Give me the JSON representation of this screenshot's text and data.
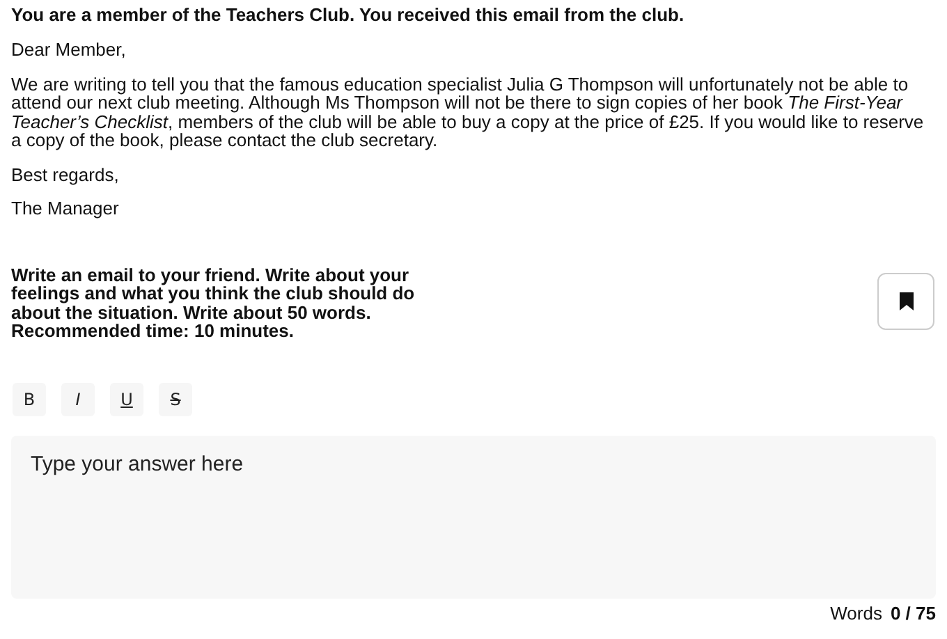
{
  "intro": "You are a member of the Teachers Club. You received this email from the club.",
  "email": [
    "Dear Member,",
    "We are writing to tell you that the famous education specialist Julia G Thompson will unfortunately not be able to attend our next club meeting. Although Ms Thompson will not be there to sign copies of her book *The First-Year Teacher’s Checklist*, members of the club will be able to buy a copy at the price of £25. If you would like to reserve a copy of the book, please contact the club secretary.",
    "Best regards,",
    "The Manager"
  ],
  "task": "Write an email to your friend. Write about your feelings and what you think the club should do about the situation. Write about 50 words. Recommended time: 10 minutes.",
  "bookmark": {
    "on": true
  },
  "toolbar": [
    {
      "label": "B",
      "kind": "bold"
    },
    {
      "label": "I",
      "kind": "italic"
    },
    {
      "label": "U",
      "kind": "underline"
    },
    {
      "label": "S",
      "kind": "strike"
    }
  ],
  "answer": {
    "placeholder": "Type your answer here"
  },
  "word_count": {
    "label": "Words",
    "value": "0 / 75"
  }
}
